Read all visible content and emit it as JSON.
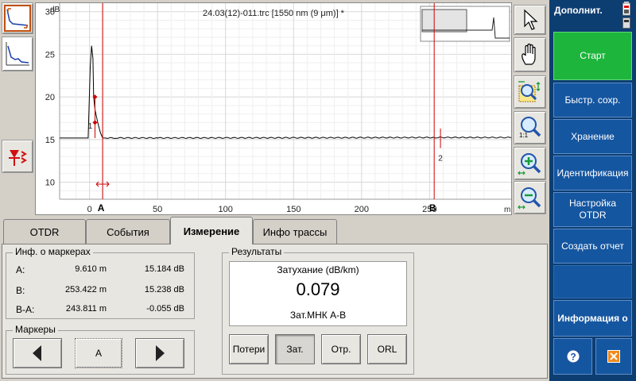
{
  "trace": {
    "title": "24.03(12)-011.trc [1550 nm (9 μm)] *",
    "y_unit": "dB",
    "x_unit": "m",
    "y_ticks": [
      "30",
      "25",
      "20",
      "15",
      "10"
    ],
    "x_ticks": [
      "0",
      "50",
      "100",
      "150",
      "200",
      "250"
    ],
    "marker_a_label": "A",
    "marker_b_label": "B",
    "event_1_label": "1",
    "event_2_label": "2",
    "colors": {
      "trace": "#000000",
      "marker": "#cc0000",
      "event": "#cc0000",
      "grid": "#d8d8d8"
    }
  },
  "chart_data": {
    "type": "line",
    "xlabel": "m",
    "ylabel": "dB",
    "xlim": [
      -22,
      310
    ],
    "ylim": [
      8,
      31
    ],
    "series": [
      {
        "x": [
          -22,
          -1,
          0.5,
          1.5,
          2.5,
          3,
          4,
          6,
          8,
          9.6,
          12,
          20,
          50,
          100,
          150,
          200,
          253.4,
          255,
          300,
          310
        ],
        "y": [
          15.18,
          15.18,
          23.5,
          26.0,
          24.5,
          20.0,
          18.5,
          17.0,
          15.8,
          15.18,
          15.18,
          15.19,
          15.19,
          15.2,
          15.21,
          15.22,
          15.24,
          15.24,
          15.24,
          15.24
        ]
      }
    ],
    "markers": [
      {
        "label": "A",
        "x": 9.6
      },
      {
        "label": "B",
        "x": 253.4
      }
    ],
    "events": [
      {
        "label": "1",
        "x": 4,
        "y": 18.5
      },
      {
        "label": "2",
        "x": 258,
        "y": 15.24
      }
    ]
  },
  "left_tools": [
    {
      "name": "zoom-full-icon"
    },
    {
      "name": "trace-overview-icon"
    },
    {
      "name": "event-marker-icon"
    }
  ],
  "right_tools": [
    {
      "name": "pointer-icon"
    },
    {
      "name": "hand-pan-icon"
    },
    {
      "name": "zoom-region-icon"
    },
    {
      "name": "zoom-1to1-icon",
      "caption": "1:1"
    },
    {
      "name": "zoom-in-icon"
    },
    {
      "name": "zoom-out-icon"
    }
  ],
  "tabs": [
    {
      "label": "OTDR",
      "active": false
    },
    {
      "label": "События",
      "active": false
    },
    {
      "label": "Измерение",
      "active": true
    },
    {
      "label": "Инфо трассы",
      "active": false
    }
  ],
  "marker_info": {
    "title": "Инф. о маркерах",
    "rows": [
      {
        "label": "A:",
        "distance": "9.610 m",
        "level": "15.184 dB"
      },
      {
        "label": "B:",
        "distance": "253.422 m",
        "level": "15.238 dB"
      },
      {
        "label": "B-A:",
        "distance": "243.811 m",
        "level": "-0.055 dB"
      }
    ]
  },
  "markers_group": {
    "title": "Маркеры",
    "current": "A"
  },
  "results": {
    "title": "Результаты",
    "measure_label": "Затухание (dB/km)",
    "value": "0.079",
    "method": "Зат.МНК А-В",
    "buttons": [
      {
        "label": "Потери",
        "pressed": false
      },
      {
        "label": "Зат.",
        "pressed": true
      },
      {
        "label": "Отр.",
        "pressed": false
      },
      {
        "label": "ORL",
        "pressed": false
      }
    ]
  },
  "sidebar": {
    "header": "Дополнит.",
    "buttons": [
      {
        "label": "Старт"
      },
      {
        "label": "Быстр. сохр."
      },
      {
        "label": "Хранение"
      },
      {
        "label": "Идентификация"
      },
      {
        "label": "Настройка OTDR"
      },
      {
        "label": "Создать отчет"
      },
      {
        "label": "Информация о"
      }
    ],
    "help_icon": "help-icon",
    "close_icon": "close-icon",
    "colors": {
      "background": "#0d3e72",
      "button": "#1556a0",
      "start": "#1db53c"
    }
  }
}
